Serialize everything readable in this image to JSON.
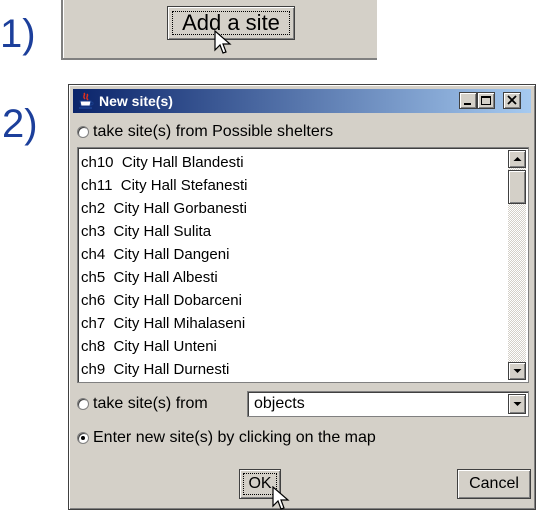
{
  "steps": {
    "one": "1)",
    "two": "2)"
  },
  "step1": {
    "add_site_label": "Add a site"
  },
  "dialog": {
    "title": "New site(s)",
    "option_shelters": "take site(s) from Possible shelters",
    "sites": [
      "ch10  City Hall Blandesti",
      "ch11  City Hall Stefanesti",
      "ch2  City Hall Gorbanesti",
      "ch3  City Hall Sulita",
      "ch4  City Hall Dangeni",
      "ch5  City Hall Albesti",
      "ch6  City Hall Dobarceni",
      "ch7  City Hall Mihalaseni",
      "ch8  City Hall Unteni",
      "ch9  City Hall Durnesti"
    ],
    "option_from": "take site(s) from",
    "objects_value": "objects",
    "option_map": "Enter new site(s) by clicking on the map",
    "ok_label": "OK",
    "cancel_label": "Cancel"
  },
  "colors": {
    "step_number": "#1c3f9b",
    "titlebar_start": "#0a246a",
    "titlebar_end": "#a6caf0",
    "face": "#d4d0c8"
  },
  "icons": [
    "java-cup-icon",
    "minimize-icon",
    "maximize-icon",
    "close-icon",
    "arrow-up-icon",
    "arrow-down-icon",
    "mouse-cursor-icon"
  ]
}
